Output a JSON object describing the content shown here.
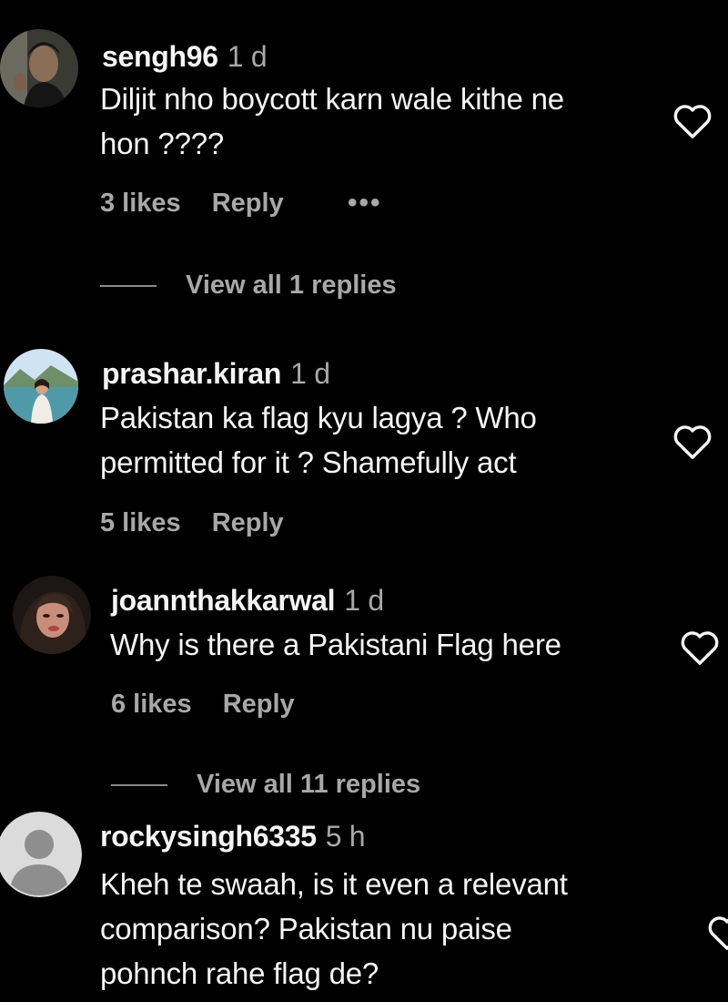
{
  "icons": {
    "heart": "heart-outline-icon",
    "more": "more-horizontal-icon"
  },
  "comments": [
    {
      "username": "sengh96",
      "time": "1 d",
      "lines": [
        "Diljit nho boycott karn wale kithe ne",
        "hon ????"
      ],
      "likes": "3 likes",
      "reply": "Reply",
      "more": "•••",
      "view_replies": "View all 1 replies"
    },
    {
      "username": "prashar.kiran",
      "time": "1 d",
      "lines": [
        "Pakistan ka flag kyu lagya ? Who",
        "permitted for it ? Shamefully act"
      ],
      "likes": "5 likes",
      "reply": "Reply"
    },
    {
      "username": "joannthakkarwal",
      "time": "1 d",
      "lines": [
        "Why is there a Pakistani Flag here"
      ],
      "likes": "6 likes",
      "reply": "Reply",
      "view_replies": "View all 11 replies"
    },
    {
      "username": "rockysingh6335",
      "time": "5 h",
      "lines": [
        "Kheh te swaah, is it even a relevant",
        "comparison? Pakistan nu paise",
        "pohnch rahe flag de?"
      ]
    }
  ]
}
